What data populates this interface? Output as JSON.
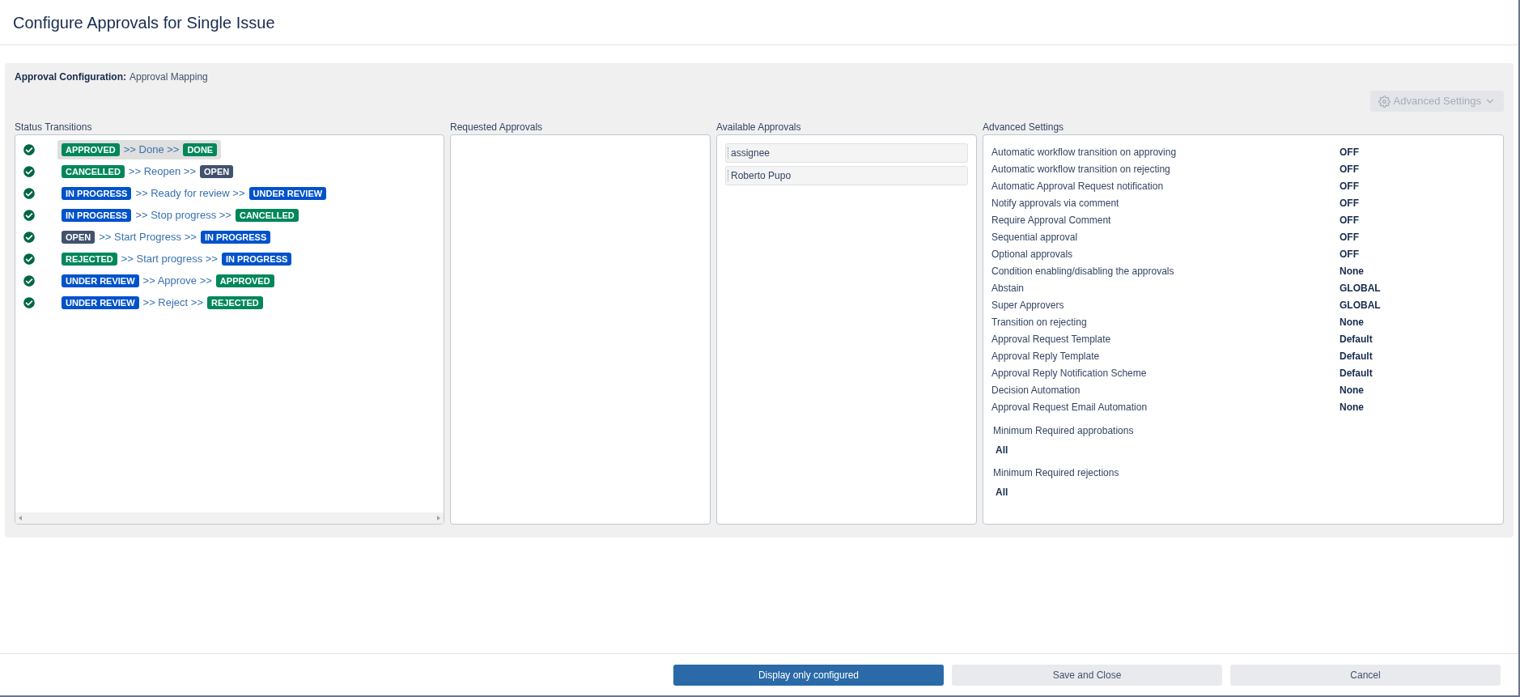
{
  "title": "Configure Approvals for Single Issue",
  "config": {
    "label": "Approval Configuration:",
    "value": "Approval Mapping"
  },
  "advanced_button": {
    "label": "Advanced Settings",
    "disabled": true
  },
  "status_transitions": {
    "heading": "Status Transitions",
    "rows": [
      {
        "from": {
          "text": "APPROVED",
          "color": "#00875a"
        },
        "action": ">> Done >>",
        "to": {
          "text": "DONE",
          "color": "#00875a"
        },
        "selected": true
      },
      {
        "from": {
          "text": "CANCELLED",
          "color": "#00875a"
        },
        "action": ">> Reopen >>",
        "to": {
          "text": "OPEN",
          "color": "#42526e"
        },
        "selected": false
      },
      {
        "from": {
          "text": "IN PROGRESS",
          "color": "#0052cc"
        },
        "action": ">> Ready for review >>",
        "to": {
          "text": "UNDER REVIEW",
          "color": "#0052cc"
        },
        "selected": false
      },
      {
        "from": {
          "text": "IN PROGRESS",
          "color": "#0052cc"
        },
        "action": ">> Stop progress >>",
        "to": {
          "text": "CANCELLED",
          "color": "#00875a"
        },
        "selected": false
      },
      {
        "from": {
          "text": "OPEN",
          "color": "#42526e"
        },
        "action": ">> Start Progress >>",
        "to": {
          "text": "IN PROGRESS",
          "color": "#0052cc"
        },
        "selected": false
      },
      {
        "from": {
          "text": "REJECTED",
          "color": "#00875a"
        },
        "action": ">> Start progress >>",
        "to": {
          "text": "IN PROGRESS",
          "color": "#0052cc"
        },
        "selected": false
      },
      {
        "from": {
          "text": "UNDER REVIEW",
          "color": "#0052cc"
        },
        "action": ">> Approve >>",
        "to": {
          "text": "APPROVED",
          "color": "#00875a"
        },
        "selected": false
      },
      {
        "from": {
          "text": "UNDER REVIEW",
          "color": "#0052cc"
        },
        "action": ">> Reject >>",
        "to": {
          "text": "REJECTED",
          "color": "#00875a"
        },
        "selected": false
      }
    ]
  },
  "requested_approvals": {
    "heading": "Requested Approvals"
  },
  "available_approvals": {
    "heading": "Available Approvals",
    "items": [
      "assignee",
      "Roberto Pupo"
    ]
  },
  "advanced_settings": {
    "heading": "Advanced Settings",
    "rows": [
      {
        "label": "Automatic workflow transition on approving",
        "value": "OFF"
      },
      {
        "label": "Automatic workflow transition on rejecting",
        "value": "OFF"
      },
      {
        "label": "Automatic Approval Request notification",
        "value": "OFF"
      },
      {
        "label": "Notify approvals via comment",
        "value": "OFF"
      },
      {
        "label": "Require Approval Comment",
        "value": "OFF"
      },
      {
        "label": "Sequential approval",
        "value": "OFF"
      },
      {
        "label": "Optional approvals",
        "value": "OFF"
      },
      {
        "label": "Condition enabling/disabling the approvals",
        "value": "None"
      },
      {
        "label": "Abstain",
        "value": "GLOBAL"
      },
      {
        "label": "Super Approvers",
        "value": "GLOBAL"
      },
      {
        "label": "Transition on rejecting",
        "value": "None"
      },
      {
        "label": "Approval Request Template",
        "value": "Default"
      },
      {
        "label": "Approval Reply Template",
        "value": "Default"
      },
      {
        "label": "Approval Reply Notification Scheme",
        "value": "Default"
      },
      {
        "label": "Decision Automation",
        "value": "None"
      },
      {
        "label": "Approval Request Email Automation",
        "value": "None"
      }
    ],
    "minimums": [
      {
        "label": "Minimum Required approbations",
        "value": "All"
      },
      {
        "label": "Minimum Required rejections",
        "value": "All"
      }
    ]
  },
  "buttons": [
    {
      "label": "Display only configured",
      "primary": true
    },
    {
      "label": "Save and Close",
      "primary": false
    },
    {
      "label": "Cancel",
      "primary": false
    }
  ]
}
